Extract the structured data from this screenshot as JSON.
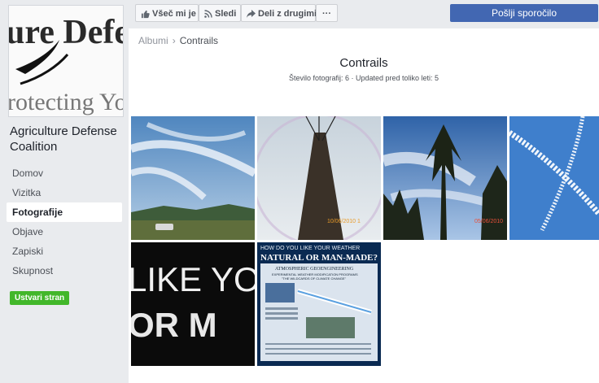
{
  "sidebar": {
    "logo_text_1": "ure Defe",
    "logo_text_2": "rotecting Yo",
    "page_name": "Agriculture Defense Coalition",
    "nav": [
      "Domov",
      "Vizitka",
      "Fotografije",
      "Objave",
      "Zapiski",
      "Skupnost"
    ],
    "active_nav": "Fotografije",
    "create_page": "Ustvari stran"
  },
  "toolbar": {
    "like": "Všeč mi je",
    "follow": "Sledi",
    "share": "Deli z drugimi",
    "more": "···",
    "message": "Pošlji sporočilo"
  },
  "breadcrumb": {
    "parent": "Albumi",
    "separator": "›",
    "current": "Contrails"
  },
  "album": {
    "title": "Contrails",
    "meta": "Število fotografij: 6 · Updated pred toliko leti: 5"
  },
  "photos": [
    {
      "label": "contrails-sky-field"
    },
    {
      "label": "utility-pole",
      "stamp": "10/06/2010 1"
    },
    {
      "label": "trees-contrails",
      "stamp": "05/06/2010"
    },
    {
      "label": "blue-sky-trails"
    },
    {
      "label": "like-your-weather",
      "text": "LIKE YO",
      "text2": "OR M"
    },
    {
      "label": "weather-poster",
      "header": "HOW DO YOU LIKE YOUR WEATHER",
      "title": "NATURAL OR MAN-MADE?",
      "subtitle": "ATMOSPHERIC GEOENGINEERING",
      "line1": "EXPERIMENTAL WEATHER MODIFICATION PROGRAMS",
      "line2": "\"THE WILDCARDS OF CLIMATE CHANGE\""
    }
  ],
  "colors": {
    "accent": "#4267b2",
    "green": "#42b72a",
    "background": "#e9ebee"
  }
}
